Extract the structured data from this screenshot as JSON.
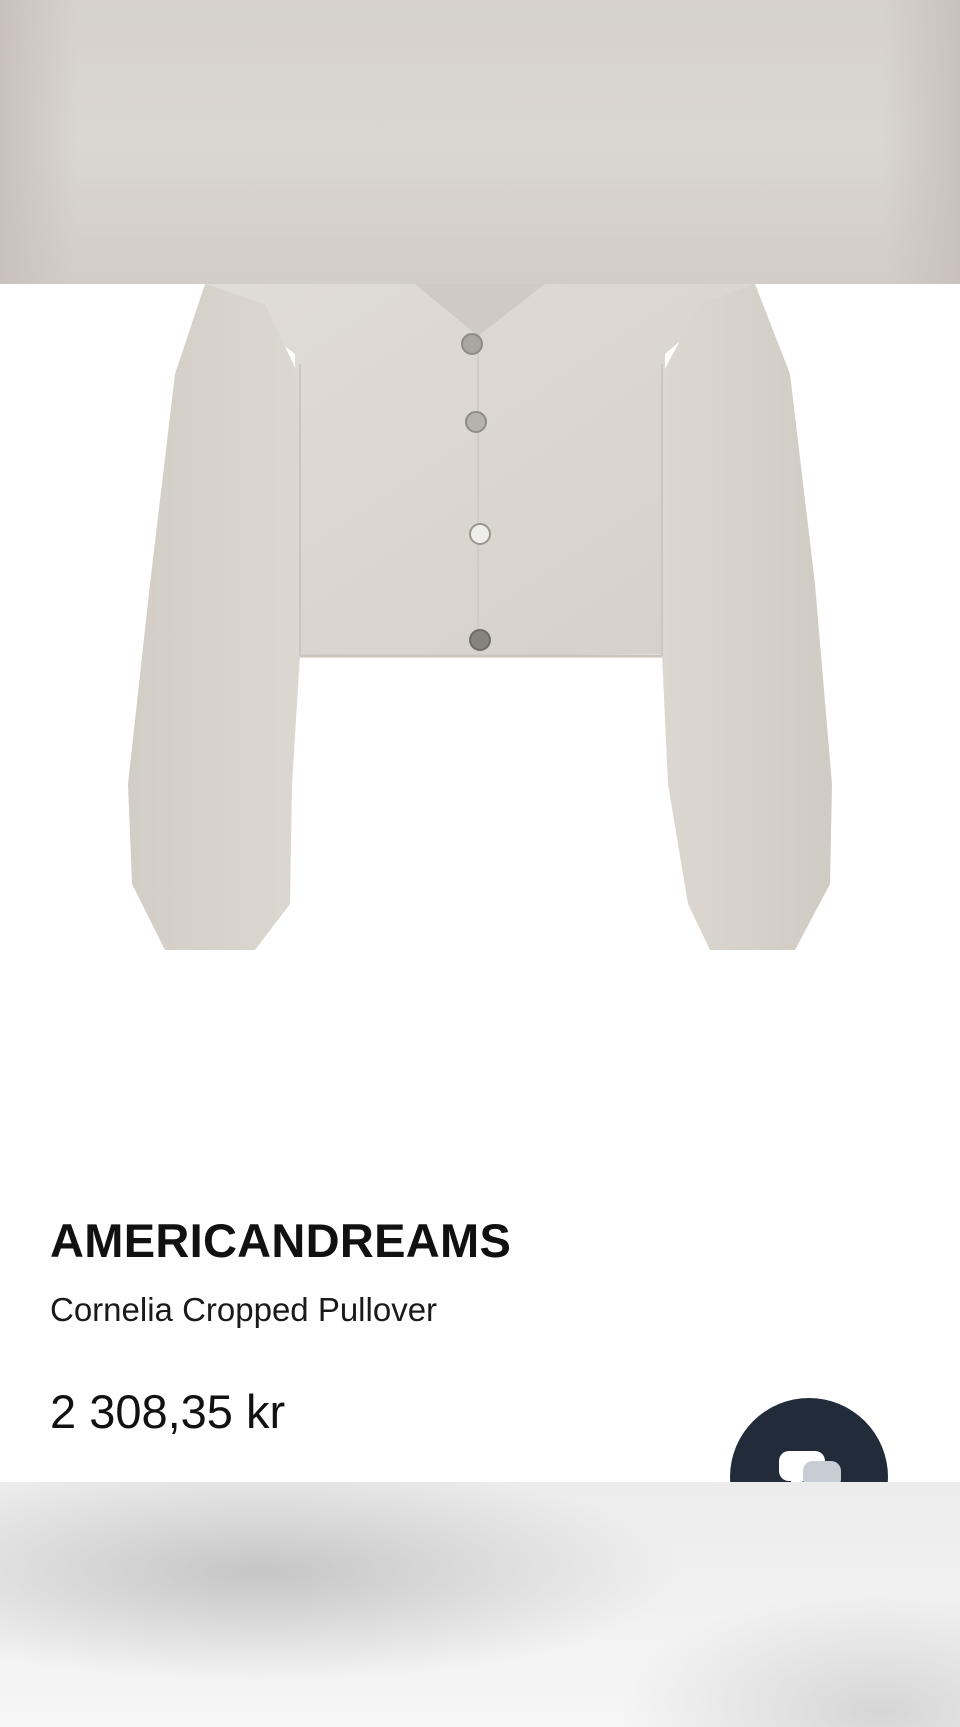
{
  "product": {
    "brand": "AMERICANDREAMS",
    "name": "Cornelia Cropped Pullover",
    "price": "2 308,35 kr",
    "image_icon": "cardigan-product-image"
  },
  "chat": {
    "icon": "chat-bubble-icon",
    "color": "#222b3a"
  },
  "colors": {
    "garment": "#dcd7d0",
    "top_strip": "#d8d3cd"
  }
}
